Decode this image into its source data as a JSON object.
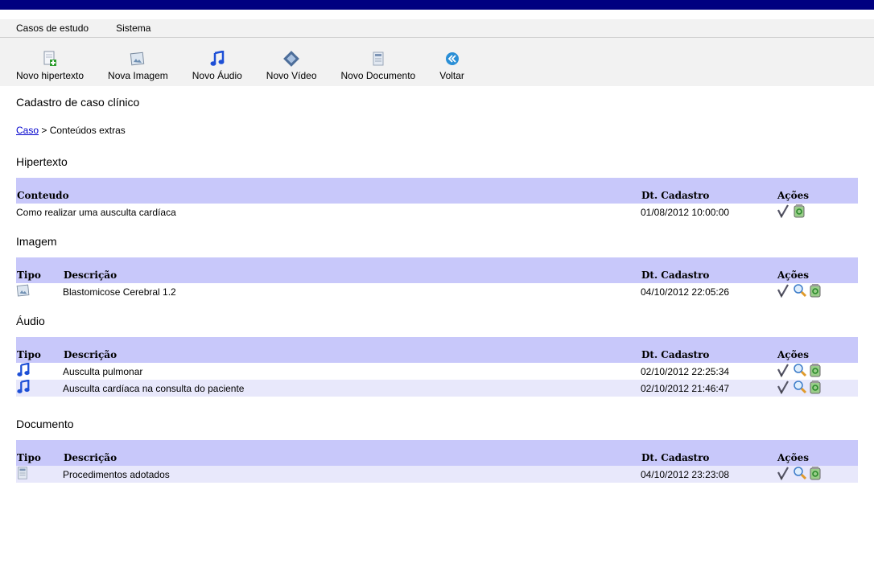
{
  "menu": [
    "Casos de estudo",
    "Sistema"
  ],
  "toolbar": [
    {
      "label": "Novo hipertexto",
      "icon": "new-hypertext-icon"
    },
    {
      "label": "Nova Imagem",
      "icon": "image-icon"
    },
    {
      "label": "Novo Áudio",
      "icon": "music-note-icon"
    },
    {
      "label": "Novo Vídeo",
      "icon": "film-icon"
    },
    {
      "label": "Novo Documento",
      "icon": "document-icon"
    },
    {
      "label": "Voltar",
      "icon": "back-arrow-icon"
    }
  ],
  "page": {
    "title": "Cadastro de caso clínico",
    "breadcrumb_link": "Caso",
    "breadcrumb_rest": " > Conteúdos extras"
  },
  "hipertexto": {
    "title": "Hipertexto",
    "headers": {
      "conteudo": "Conteudo",
      "data": "Dt. Cadastro",
      "acoes": "Ações"
    },
    "rows": [
      {
        "conteudo": "Como realizar uma ausculta cardíaca",
        "data": "01/08/2012 10:00:00"
      }
    ]
  },
  "imagem": {
    "title": "Imagem",
    "headers": {
      "tipo": "Tipo",
      "descricao": "Descrição",
      "data": "Dt. Cadastro",
      "acoes": "Ações"
    },
    "rows": [
      {
        "descricao": "Blastomicose Cerebral 1.2",
        "data": "04/10/2012 22:05:26"
      }
    ]
  },
  "audio": {
    "title": "Áudio",
    "headers": {
      "tipo": "Tipo",
      "descricao": "Descrição",
      "data": "Dt. Cadastro",
      "acoes": "Ações"
    },
    "rows": [
      {
        "descricao": "Ausculta pulmonar",
        "data": "02/10/2012 22:25:34"
      },
      {
        "descricao": "Ausculta cardíaca na consulta do paciente",
        "data": "02/10/2012 21:46:47"
      }
    ]
  },
  "documento": {
    "title": "Documento",
    "headers": {
      "tipo": "Tipo",
      "descricao": "Descrição",
      "data": "Dt. Cadastro",
      "acoes": "Ações"
    },
    "rows": [
      {
        "descricao": "Procedimentos adotados",
        "data": "04/10/2012 23:23:08"
      }
    ]
  },
  "colors": {
    "topbar": "#000080",
    "table_header": "#c8c8fa",
    "alt_row": "#e8e8fb",
    "link": "#0000cc"
  }
}
